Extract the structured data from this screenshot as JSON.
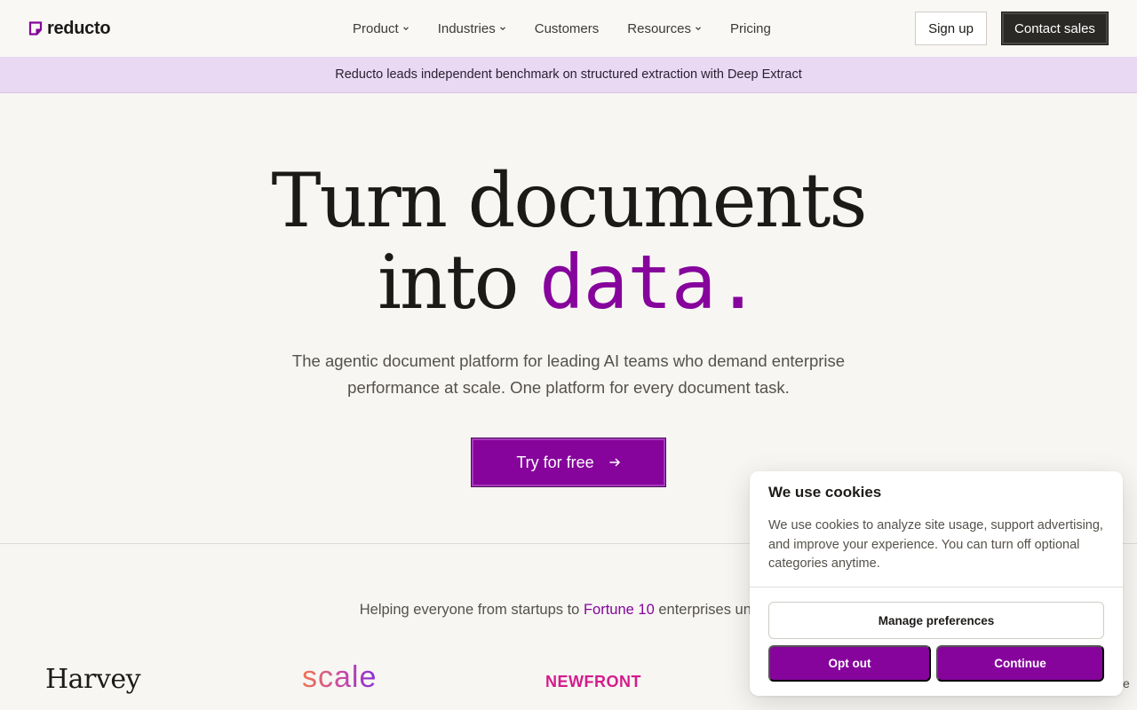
{
  "nav": {
    "logo_text": "reducto",
    "links": [
      {
        "label": "Product",
        "has_dropdown": true
      },
      {
        "label": "Industries",
        "has_dropdown": true
      },
      {
        "label": "Customers",
        "has_dropdown": false
      },
      {
        "label": "Resources",
        "has_dropdown": true
      },
      {
        "label": "Pricing",
        "has_dropdown": false
      }
    ],
    "signup_label": "Sign up",
    "contact_label": "Contact sales"
  },
  "banner": {
    "text": "Reducto leads independent benchmark on structured extraction with Deep Extract"
  },
  "hero": {
    "title_line1": "Turn documents",
    "title_line2_plain": "into ",
    "title_line2_accent": "data.",
    "subtitle": "The agentic document platform for leading AI teams who demand enterprise performance at scale. One platform for every document task.",
    "cta_label": "Try for free"
  },
  "customers": {
    "lead_before": "Helping everyone from startups to ",
    "lead_highlight": "Fortune 10",
    "lead_after": " enterprises unlock",
    "logos": [
      "Harvey",
      "scale",
      "NEWFRONT"
    ]
  },
  "cookie": {
    "title": "We use cookies",
    "text": "We use cookies to analyze site usage, support advertising, and improve your experience. You can turn off optional categories anytime.",
    "manage_label": "Manage preferences",
    "optout_label": "Opt out",
    "continue_label": "Continue"
  },
  "colors": {
    "accent": "#86049c",
    "banner_bg": "#e9d9f3",
    "page_bg": "#f7f6f3",
    "dark_button": "#2b2926"
  }
}
